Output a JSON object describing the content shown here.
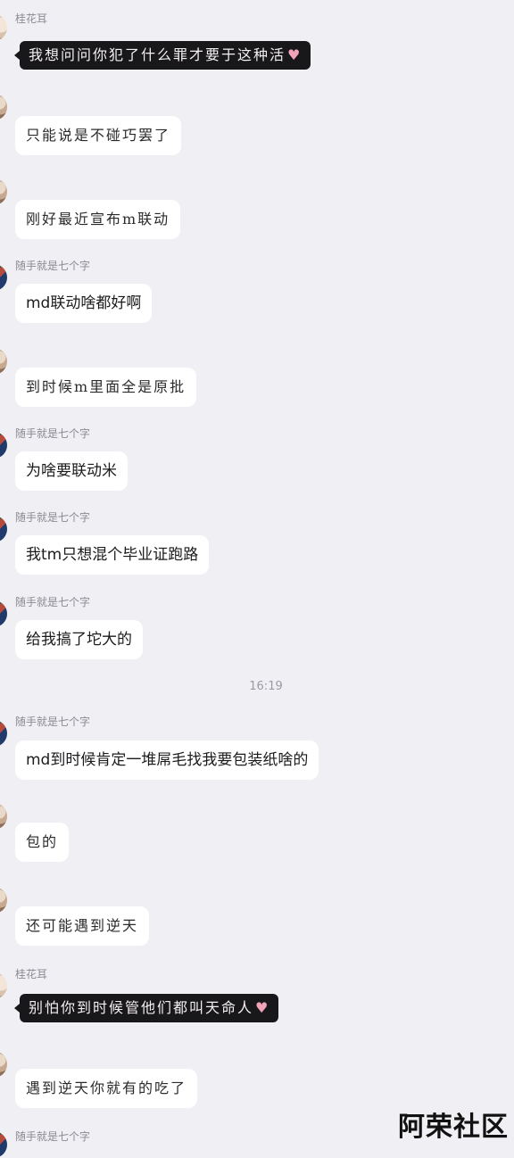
{
  "messages": [
    {
      "sender": "桂花耳",
      "text": "我想问问你犯了什么罪才要于这种活",
      "style": "dark",
      "heart": "♥"
    },
    {
      "sender": "",
      "text": "只能说是不碰巧罢了",
      "style": "hand"
    },
    {
      "sender": "",
      "text": "刚好最近宣布m联动",
      "style": "hand"
    },
    {
      "sender": "随手就是七个字",
      "text": "md联动啥都好啊",
      "style": "normal"
    },
    {
      "sender": "",
      "text": "到时候m里面全是原批",
      "style": "hand"
    },
    {
      "sender": "随手就是七个字",
      "text": "为啥要联动米",
      "style": "normal"
    },
    {
      "sender": "随手就是七个字",
      "text": "我tm只想混个毕业证跑路",
      "style": "normal"
    },
    {
      "sender": "随手就是七个字",
      "text": "给我搞了坨大的",
      "style": "normal"
    },
    {
      "sender": "随手就是七个字",
      "text": "md到时候肯定一堆屌毛找我要包装纸啥的",
      "style": "normal"
    },
    {
      "sender": "",
      "text": "包的",
      "style": "hand"
    },
    {
      "sender": "",
      "text": "还可能遇到逆天",
      "style": "hand"
    },
    {
      "sender": "桂花耳",
      "text": "别怕你到时候管他们都叫天命人",
      "style": "dark",
      "heart": "♥"
    },
    {
      "sender": "",
      "text": "遇到逆天你就有的吃了",
      "style": "hand"
    },
    {
      "sender": "随手就是七个字",
      "text": "",
      "style": "none"
    }
  ],
  "timestamp": "16:19",
  "watermark": "阿荣社区",
  "colors": {
    "background": "#f0f0f4",
    "bubble": "#ffffff",
    "dark_bubble": "#18181b",
    "heart": "#f2a3b7"
  }
}
